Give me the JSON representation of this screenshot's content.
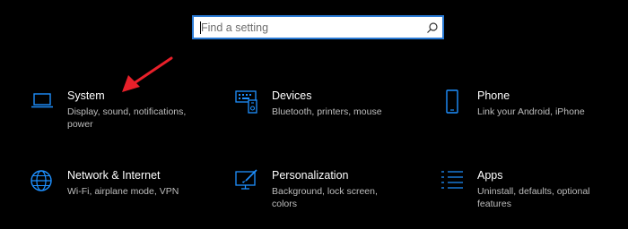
{
  "search": {
    "placeholder": "Find a setting"
  },
  "tiles": [
    {
      "title": "System",
      "description": "Display, sound, notifications, power",
      "icon": "laptop-icon"
    },
    {
      "title": "Devices",
      "description": "Bluetooth, printers, mouse",
      "icon": "devices-icon"
    },
    {
      "title": "Phone",
      "description": "Link your Android, iPhone",
      "icon": "phone-icon"
    },
    {
      "title": "Network & Internet",
      "description": "Wi-Fi, airplane mode, VPN",
      "icon": "globe-icon"
    },
    {
      "title": "Personalization",
      "description": "Background, lock screen, colors",
      "icon": "paint-icon"
    },
    {
      "title": "Apps",
      "description": "Uninstall, defaults, optional features",
      "icon": "apps-list-icon"
    }
  ],
  "colors": {
    "accent": "#2a7bd6",
    "icon": "#1e90ff",
    "annotation_arrow": "#e8202a",
    "background": "#000000"
  }
}
